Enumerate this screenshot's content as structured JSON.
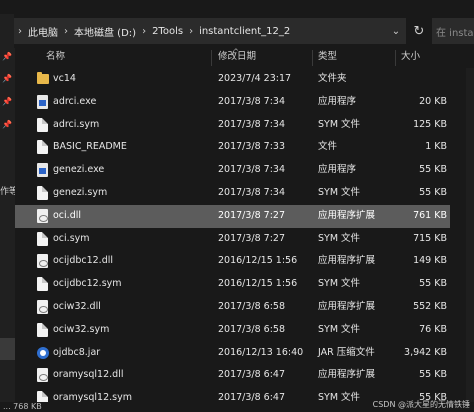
{
  "breadcrumbs": [
    "此电脑",
    "本地磁盘 (D:)",
    "2Tools",
    "instantclient_12_2"
  ],
  "search_placeholder": "在 instantc",
  "nav": {
    "partial_text": "作等"
  },
  "columns": {
    "name": "名称",
    "date": "修改日期",
    "type": "类型",
    "size": "大小"
  },
  "files": [
    {
      "name": "vc14",
      "date": "2023/7/4 23:17",
      "type": "文件夹",
      "size": "",
      "icon": "folder-icon"
    },
    {
      "name": "adrci.exe",
      "date": "2017/3/8 7:34",
      "type": "应用程序",
      "size": "20 KB",
      "icon": "exe-icon"
    },
    {
      "name": "adrci.sym",
      "date": "2017/3/8 7:34",
      "type": "SYM 文件",
      "size": "125 KB",
      "icon": "file-icon"
    },
    {
      "name": "BASIC_README",
      "date": "2017/3/8 7:33",
      "type": "文件",
      "size": "1 KB",
      "icon": "file-icon"
    },
    {
      "name": "genezi.exe",
      "date": "2017/3/8 7:34",
      "type": "应用程序",
      "size": "55 KB",
      "icon": "exe-icon"
    },
    {
      "name": "genezi.sym",
      "date": "2017/3/8 7:34",
      "type": "SYM 文件",
      "size": "55 KB",
      "icon": "file-icon"
    },
    {
      "name": "oci.dll",
      "date": "2017/3/8 7:27",
      "type": "应用程序扩展",
      "size": "761 KB",
      "icon": "dll-icon"
    },
    {
      "name": "oci.sym",
      "date": "2017/3/8 7:27",
      "type": "SYM 文件",
      "size": "715 KB",
      "icon": "file-icon"
    },
    {
      "name": "ocijdbc12.dll",
      "date": "2016/12/15 1:56",
      "type": "应用程序扩展",
      "size": "149 KB",
      "icon": "dll-icon"
    },
    {
      "name": "ocijdbc12.sym",
      "date": "2016/12/15 1:56",
      "type": "SYM 文件",
      "size": "55 KB",
      "icon": "file-icon"
    },
    {
      "name": "ociw32.dll",
      "date": "2017/3/8 6:58",
      "type": "应用程序扩展",
      "size": "552 KB",
      "icon": "dll-icon"
    },
    {
      "name": "ociw32.sym",
      "date": "2017/3/8 6:58",
      "type": "SYM 文件",
      "size": "76 KB",
      "icon": "file-icon"
    },
    {
      "name": "ojdbc8.jar",
      "date": "2016/12/13 16:40",
      "type": "JAR 压缩文件",
      "size": "3,942 KB",
      "icon": "jar-icon"
    },
    {
      "name": "oramysql12.dll",
      "date": "2017/3/8 6:47",
      "type": "应用程序扩展",
      "size": "55 KB",
      "icon": "dll-icon"
    },
    {
      "name": "oramysql12.sym",
      "date": "2017/3/8 6:47",
      "type": "SYM 文件",
      "size": "55 KB",
      "icon": "file-icon"
    }
  ],
  "selected_file": "oci.dll",
  "status": "... 768 KB",
  "watermark": "CSDN @派大星的无情铁锤",
  "colors": {
    "background": "#191919",
    "selected_row": "#5c5c5c",
    "folder": "#e8b84a"
  }
}
